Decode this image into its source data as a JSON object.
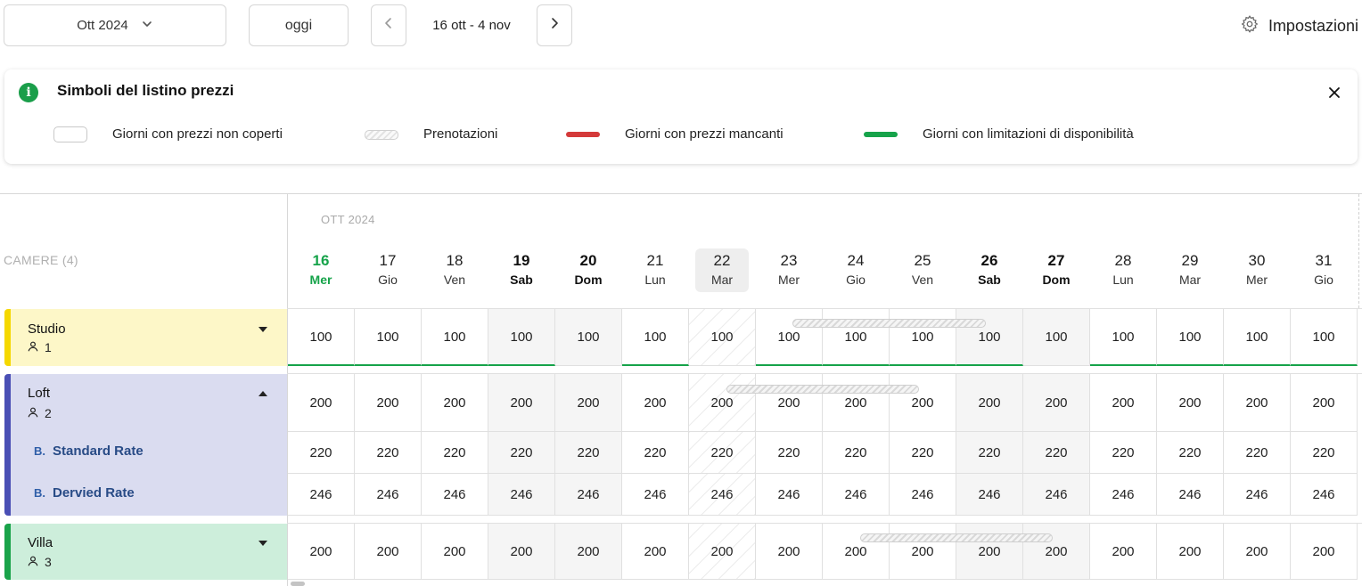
{
  "toolbar": {
    "month_value": "Ott 2024",
    "today_label": "oggi",
    "date_range": "16 ott - 4 nov",
    "settings_label": "Impostazioni"
  },
  "legend": {
    "title": "Simboli del listino prezzi",
    "items": [
      {
        "symbol": "empty",
        "label": "Giorni con prezzi non coperti"
      },
      {
        "symbol": "hatched",
        "label": "Prenotazioni"
      },
      {
        "symbol": "red-line",
        "label": "Giorni con prezzi mancanti",
        "color": "#d43a3a"
      },
      {
        "symbol": "green-line",
        "label": "Giorni con limitazioni di disponibilità",
        "color": "#16a34a"
      }
    ]
  },
  "calendar": {
    "month_label": "OTT 2024",
    "rooms_label": "CAMERE (4)",
    "days": [
      {
        "num": "16",
        "name": "Mer",
        "weekend": false,
        "today": true
      },
      {
        "num": "17",
        "name": "Gio",
        "weekend": false
      },
      {
        "num": "18",
        "name": "Ven",
        "weekend": false
      },
      {
        "num": "19",
        "name": "Sab",
        "weekend": true
      },
      {
        "num": "20",
        "name": "Dom",
        "weekend": true
      },
      {
        "num": "21",
        "name": "Lun",
        "weekend": false
      },
      {
        "num": "22",
        "name": "Mar",
        "weekend": false,
        "selected": true
      },
      {
        "num": "23",
        "name": "Mer",
        "weekend": false
      },
      {
        "num": "24",
        "name": "Gio",
        "weekend": false
      },
      {
        "num": "25",
        "name": "Ven",
        "weekend": false
      },
      {
        "num": "26",
        "name": "Sab",
        "weekend": true
      },
      {
        "num": "27",
        "name": "Dom",
        "weekend": true
      },
      {
        "num": "28",
        "name": "Lun",
        "weekend": false
      },
      {
        "num": "29",
        "name": "Mar",
        "weekend": false
      },
      {
        "num": "30",
        "name": "Mer",
        "weekend": false
      },
      {
        "num": "31",
        "name": "Gio",
        "weekend": false
      }
    ],
    "colors": {
      "today": "#16a34a",
      "availability_line": "#16a34a",
      "missing_price": "#d43a3a"
    }
  },
  "rooms": [
    {
      "name": "Studio",
      "occupancy": "1",
      "color": "#f5d800",
      "bg": "#fdf7c8",
      "expanded": false,
      "rows": [
        {
          "values": [
            "100",
            "100",
            "100",
            "100",
            "100",
            "100",
            "100",
            "100",
            "100",
            "100",
            "100",
            "100",
            "100",
            "100",
            "100",
            "100"
          ],
          "availability": [
            true,
            true,
            true,
            true,
            false,
            true,
            false,
            true,
            true,
            true,
            true,
            false,
            true,
            true,
            true,
            true
          ]
        }
      ]
    },
    {
      "name": "Loft",
      "occupancy": "2",
      "color": "#4a4fb5",
      "bg": "#dadcf0",
      "expanded": true,
      "rows": [
        {
          "values": [
            "200",
            "200",
            "200",
            "200",
            "200",
            "200",
            "200",
            "200",
            "200",
            "200",
            "200",
            "200",
            "200",
            "200",
            "200",
            "200"
          ]
        },
        {
          "label": "Standard Rate",
          "values": [
            "220",
            "220",
            "220",
            "220",
            "220",
            "220",
            "220",
            "220",
            "220",
            "220",
            "220",
            "220",
            "220",
            "220",
            "220",
            "220"
          ]
        },
        {
          "label": "Dervied Rate",
          "values": [
            "246",
            "246",
            "246",
            "246",
            "246",
            "246",
            "246",
            "246",
            "246",
            "246",
            "246",
            "246",
            "246",
            "246",
            "246",
            "246"
          ]
        }
      ]
    },
    {
      "name": "Villa",
      "occupancy": "3",
      "color": "#1aa34a",
      "bg": "#cdeedb",
      "expanded": false,
      "rows": [
        {
          "values": [
            "200",
            "200",
            "200",
            "200",
            "200",
            "200",
            "200",
            "200",
            "200",
            "200",
            "200",
            "200",
            "200",
            "200",
            "200",
            "200"
          ]
        }
      ]
    }
  ],
  "rate_logo": "B."
}
